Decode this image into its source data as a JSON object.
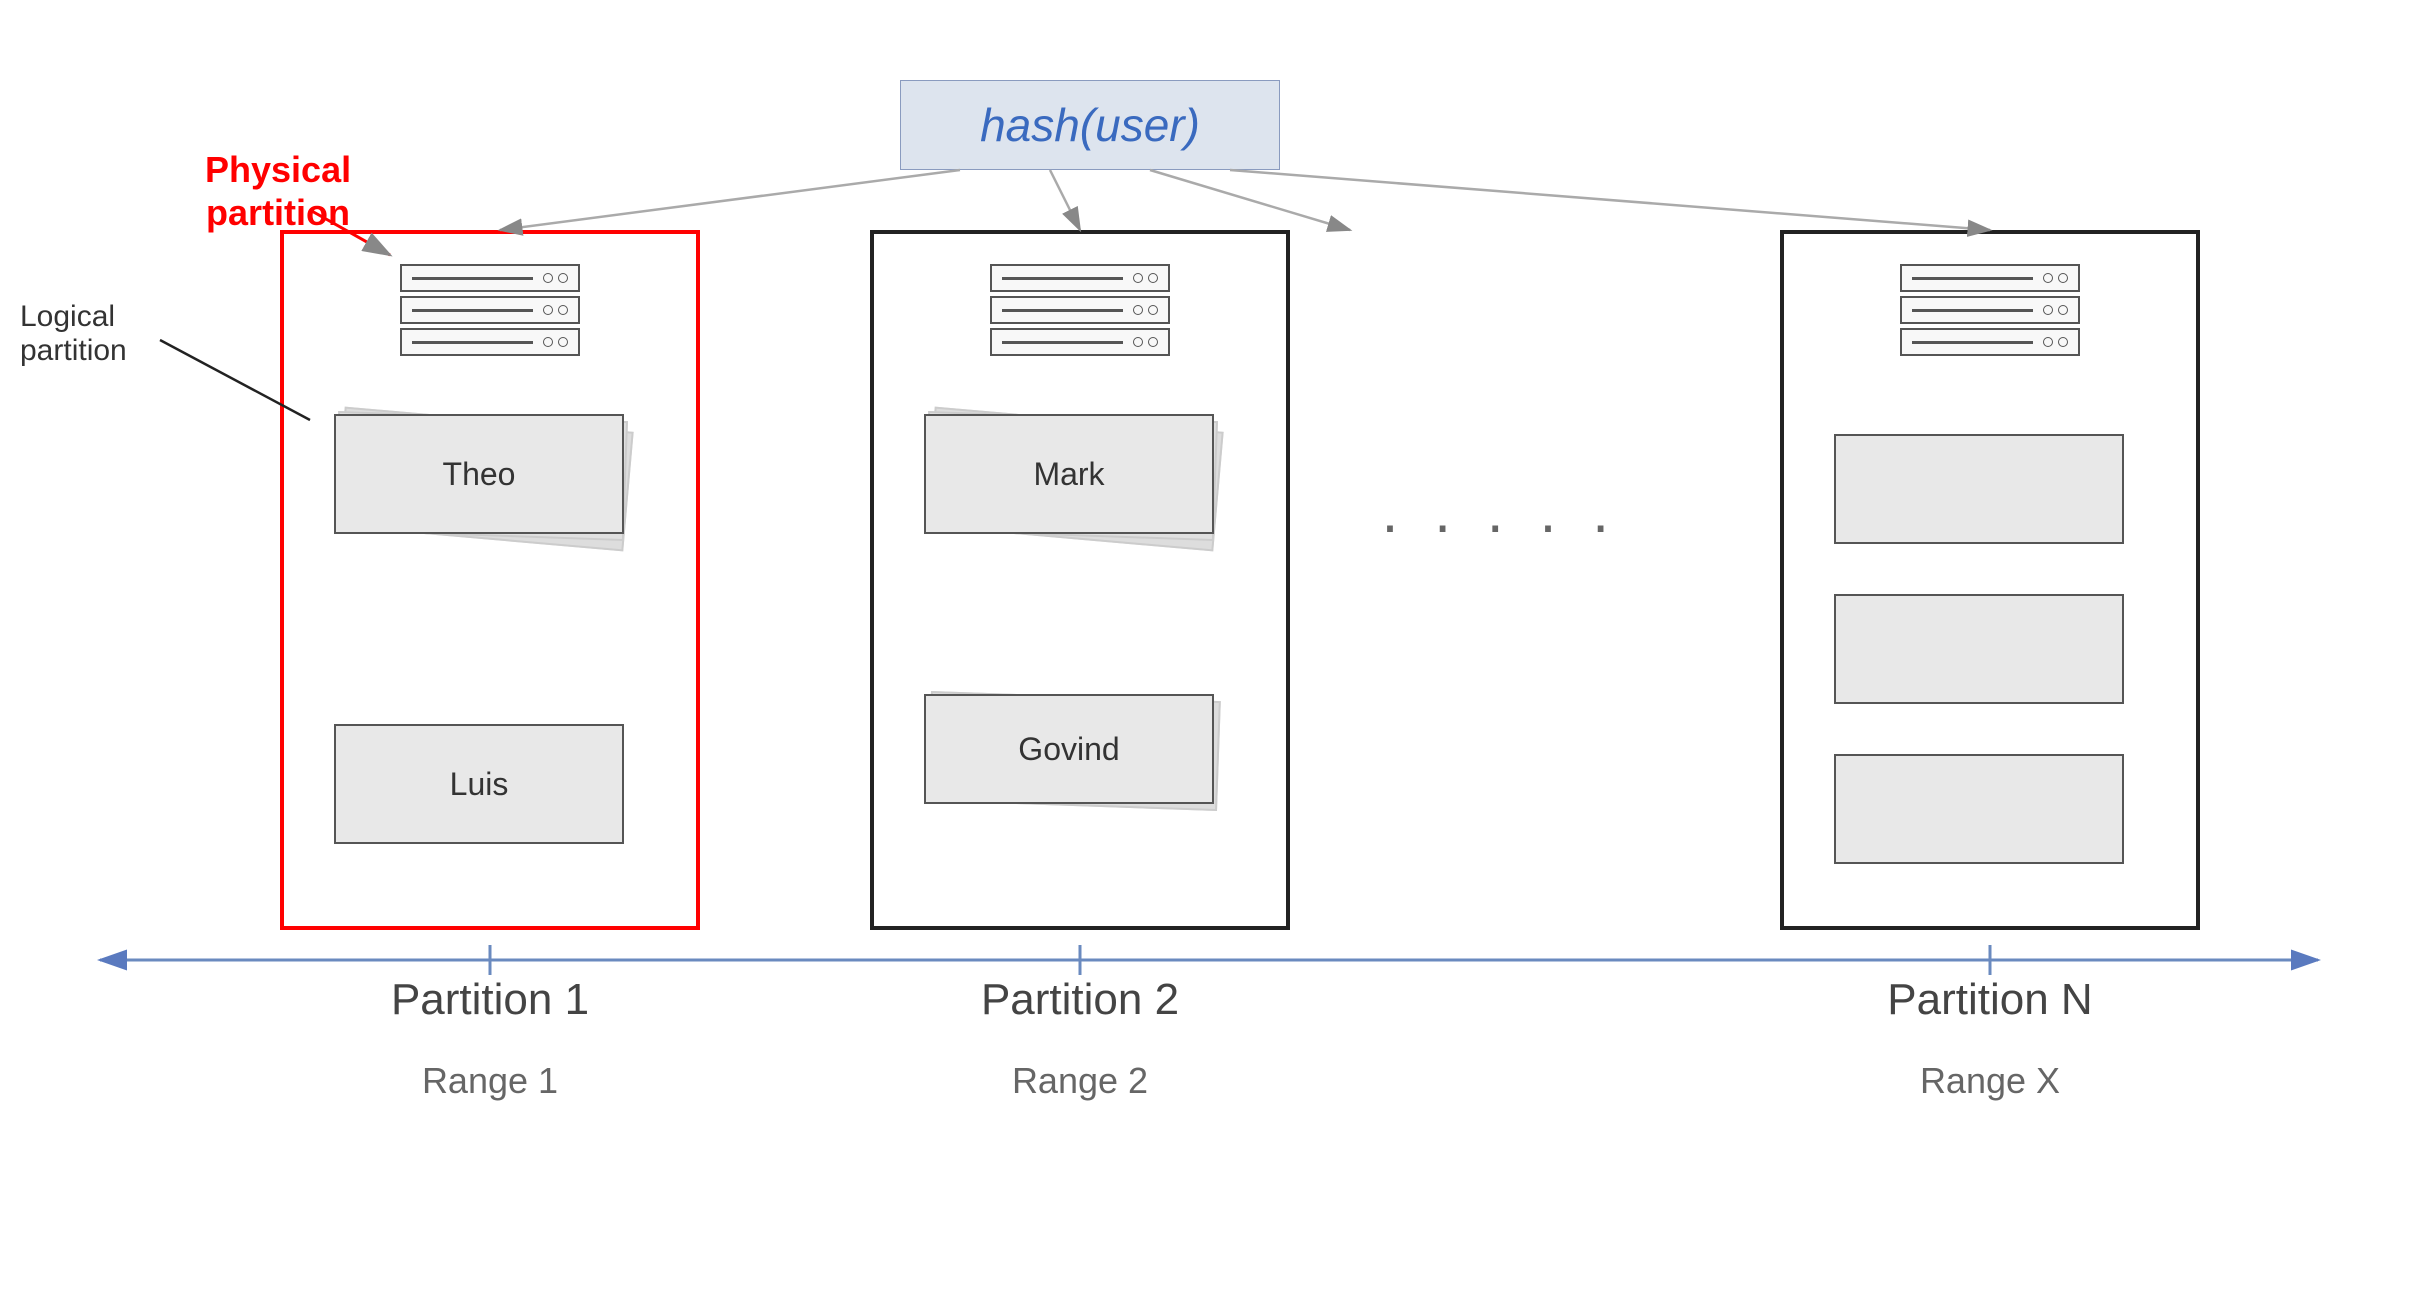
{
  "hash_box": {
    "label": "hash(user)"
  },
  "labels": {
    "physical_partition_line1": "Physical",
    "physical_partition_line2": "partition",
    "logical_partition": "Logical\npartition",
    "partition_1": "Partition 1",
    "partition_2": "Partition 2",
    "partition_n": "Partition N",
    "range_1": "Range 1",
    "range_2": "Range 2",
    "range_x": "Range X",
    "ellipsis": "· · · · ·"
  },
  "records": {
    "partition1": [
      "Theo",
      "Luis"
    ],
    "partition2": [
      "Mark",
      "Govind"
    ]
  }
}
